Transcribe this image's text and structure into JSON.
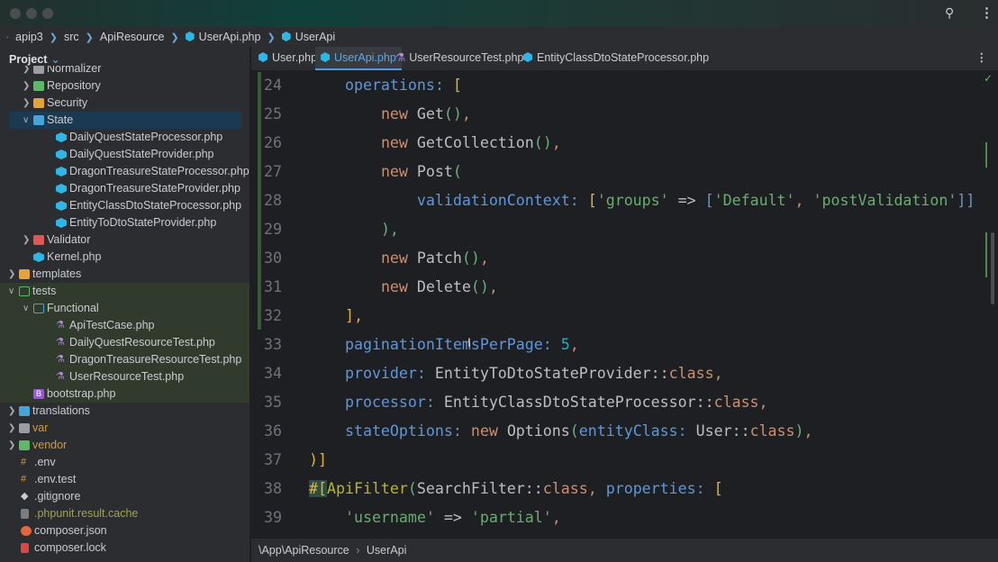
{
  "breadcrumbs": [
    "apip3",
    "src",
    "ApiResource",
    "UserApi.php",
    "UserApi"
  ],
  "sidebar": {
    "title": "Project",
    "items": [
      {
        "label": "Normalizer",
        "depth": 2,
        "arrow": "right",
        "icon": "folder-gray"
      },
      {
        "label": "Repository",
        "depth": 2,
        "arrow": "right",
        "icon": "folder-green"
      },
      {
        "label": "Security",
        "depth": 2,
        "arrow": "right",
        "icon": "folder-orange"
      },
      {
        "label": "State",
        "depth": 2,
        "arrow": "down",
        "icon": "folder-blue",
        "selected": true
      },
      {
        "label": "DailyQuestStateProcessor.php",
        "depth": 3,
        "icon": "php"
      },
      {
        "label": "DailyQuestStateProvider.php",
        "depth": 3,
        "icon": "php"
      },
      {
        "label": "DragonTreasureStateProcessor.php",
        "depth": 3,
        "icon": "php"
      },
      {
        "label": "DragonTreasureStateProvider.php",
        "depth": 3,
        "icon": "php"
      },
      {
        "label": "EntityClassDtoStateProcessor.php",
        "depth": 3,
        "icon": "php"
      },
      {
        "label": "EntityToDtoStateProvider.php",
        "depth": 3,
        "icon": "php"
      },
      {
        "label": "Validator",
        "depth": 2,
        "arrow": "right",
        "icon": "folder-red"
      },
      {
        "label": "Kernel.php",
        "depth": 2,
        "icon": "php"
      },
      {
        "label": "templates",
        "depth": 1,
        "arrow": "right",
        "icon": "folder-orange"
      },
      {
        "label": "tests",
        "depth": 1,
        "arrow": "down",
        "icon": "folder-green-outline",
        "test": true
      },
      {
        "label": "Functional",
        "depth": 2,
        "arrow": "down",
        "icon": "folder-blue-outline",
        "test": true
      },
      {
        "label": "ApiTestCase.php",
        "depth": 3,
        "icon": "test",
        "test": true
      },
      {
        "label": "DailyQuestResourceTest.php",
        "depth": 3,
        "icon": "test",
        "test": true
      },
      {
        "label": "DragonTreasureResourceTest.php",
        "depth": 3,
        "icon": "test",
        "test": true
      },
      {
        "label": "UserResourceTest.php",
        "depth": 3,
        "icon": "test",
        "test": true
      },
      {
        "label": "bootstrap.php",
        "depth": 2,
        "icon": "bootstrap",
        "test": true
      },
      {
        "label": "translations",
        "depth": 1,
        "arrow": "right",
        "icon": "folder-blue"
      },
      {
        "label": "var",
        "depth": 1,
        "arrow": "right",
        "icon": "folder-gray",
        "color": "#d29a3c"
      },
      {
        "label": "vendor",
        "depth": 1,
        "arrow": "right",
        "icon": "folder-green",
        "color": "#d29a3c"
      },
      {
        "label": ".env",
        "depth": 1,
        "icon": "env"
      },
      {
        "label": ".env.test",
        "depth": 1,
        "icon": "env"
      },
      {
        "label": ".gitignore",
        "depth": 1,
        "icon": "git"
      },
      {
        "label": ".phpunit.result.cache",
        "depth": 1,
        "icon": "file",
        "color": "#a4a34a"
      },
      {
        "label": "composer.json",
        "depth": 1,
        "icon": "composer"
      },
      {
        "label": "composer.lock",
        "depth": 1,
        "icon": "lock"
      }
    ]
  },
  "tabs": [
    {
      "label": "User.php",
      "icon": "php"
    },
    {
      "label": "UserApi.php",
      "icon": "php",
      "active": true
    },
    {
      "label": "UserResourceTest.php",
      "icon": "test"
    },
    {
      "label": "EntityClassDtoStateProcessor.php",
      "icon": "php"
    }
  ],
  "code": [
    {
      "n": "24",
      "t": [
        [
          "    ",
          ""
        ],
        [
          "operations: ",
          "pr"
        ],
        [
          "[",
          "br"
        ]
      ]
    },
    {
      "n": "25",
      "t": [
        [
          "        ",
          ""
        ],
        [
          "new ",
          "kw"
        ],
        [
          "Get",
          "nm"
        ],
        [
          "()",
          "pa"
        ],
        [
          ",",
          "kw"
        ]
      ]
    },
    {
      "n": "26",
      "t": [
        [
          "        ",
          ""
        ],
        [
          "new ",
          "kw"
        ],
        [
          "GetCollection",
          "nm"
        ],
        [
          "()",
          "pa"
        ],
        [
          ",",
          "kw"
        ]
      ]
    },
    {
      "n": "27",
      "t": [
        [
          "        ",
          ""
        ],
        [
          "new ",
          "kw"
        ],
        [
          "Post",
          "nm"
        ],
        [
          "(",
          "pa"
        ]
      ]
    },
    {
      "n": "28",
      "t": [
        [
          "            ",
          ""
        ],
        [
          "validationContext: ",
          "pr"
        ],
        [
          "[",
          "br"
        ],
        [
          "'groups'",
          "st"
        ],
        [
          " => ",
          "pn"
        ],
        [
          "[",
          "pr"
        ],
        [
          "'Default'",
          "st"
        ],
        [
          ", ",
          "kw"
        ],
        [
          "'postValidation'",
          "st"
        ],
        [
          "]]",
          "pr"
        ]
      ]
    },
    {
      "n": "29",
      "t": [
        [
          "        ",
          ""
        ],
        [
          "),",
          "pa"
        ]
      ]
    },
    {
      "n": "30",
      "t": [
        [
          "        ",
          ""
        ],
        [
          "new ",
          "kw"
        ],
        [
          "Patch",
          "nm"
        ],
        [
          "()",
          "pa"
        ],
        [
          ",",
          "kw"
        ]
      ]
    },
    {
      "n": "31",
      "t": [
        [
          "        ",
          ""
        ],
        [
          "new ",
          "kw"
        ],
        [
          "Delete",
          "nm"
        ],
        [
          "()",
          "pa"
        ],
        [
          ",",
          "kw"
        ]
      ]
    },
    {
      "n": "32",
      "t": [
        [
          "    ",
          ""
        ],
        [
          "],",
          "br"
        ]
      ]
    },
    {
      "n": "33",
      "t": [
        [
          "    ",
          ""
        ],
        [
          "paginationItemsPerPage: ",
          "pr"
        ],
        [
          "5",
          "num"
        ],
        [
          ",",
          "kw"
        ]
      ]
    },
    {
      "n": "34",
      "t": [
        [
          "    ",
          ""
        ],
        [
          "provider: ",
          "pr"
        ],
        [
          "EntityToDtoStateProvider",
          "nm"
        ],
        [
          "::",
          "pn"
        ],
        [
          "class",
          "kw"
        ],
        [
          ",",
          "kw"
        ]
      ]
    },
    {
      "n": "35",
      "t": [
        [
          "    ",
          ""
        ],
        [
          "processor: ",
          "pr"
        ],
        [
          "EntityClassDtoStateProcessor",
          "nm"
        ],
        [
          "::",
          "pn"
        ],
        [
          "class",
          "kw"
        ],
        [
          ",",
          "kw"
        ]
      ]
    },
    {
      "n": "36",
      "t": [
        [
          "    ",
          ""
        ],
        [
          "stateOptions: ",
          "pr"
        ],
        [
          "new ",
          "kw"
        ],
        [
          "Options",
          "nm"
        ],
        [
          "(",
          "pa"
        ],
        [
          "entityClass: ",
          "pr"
        ],
        [
          "User",
          "nm"
        ],
        [
          "::",
          "pn"
        ],
        [
          "class",
          "kw"
        ],
        [
          ")",
          "pa"
        ],
        [
          ",",
          "kw"
        ]
      ]
    },
    {
      "n": "37",
      "t": [
        [
          ")]",
          "br"
        ]
      ]
    },
    {
      "n": "38",
      "t": [
        [
          "#[",
          "br hl"
        ],
        [
          "ApiFilter",
          "attr"
        ],
        [
          "(",
          "pa"
        ],
        [
          "SearchFilter",
          "nm"
        ],
        [
          "::",
          "pn"
        ],
        [
          "class",
          "kw"
        ],
        [
          ", ",
          "kw"
        ],
        [
          "properties: ",
          "pr"
        ],
        [
          "[",
          "br"
        ]
      ]
    },
    {
      "n": "39",
      "t": [
        [
          "    ",
          ""
        ],
        [
          "'username'",
          "st"
        ],
        [
          " => ",
          "pn"
        ],
        [
          "'partial'",
          "st"
        ],
        [
          ",",
          "kw"
        ]
      ]
    }
  ],
  "status_path": [
    "\\App\\ApiResource",
    "UserApi"
  ]
}
